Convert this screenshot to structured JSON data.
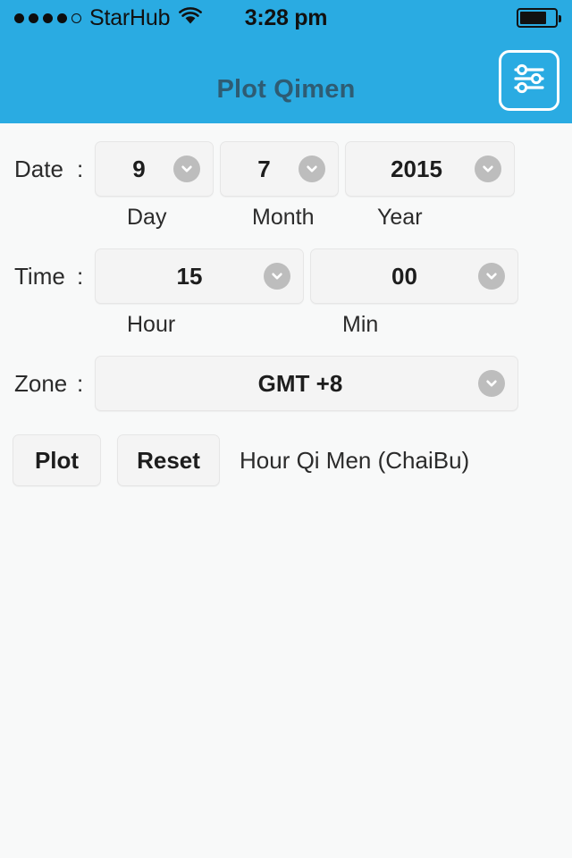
{
  "status_bar": {
    "signal_dots_filled": 4,
    "signal_dots_total": 5,
    "carrier": "StarHub",
    "wifi_icon": "wifi-icon",
    "time": "3:28 pm",
    "battery_icon": "battery-icon",
    "battery_level_percent": 75
  },
  "nav": {
    "title": "Plot Qimen",
    "settings_icon": "sliders-icon",
    "background_color": "#2aabe2",
    "title_color": "#2e5c73"
  },
  "form": {
    "date": {
      "label": "Date",
      "colon": ":",
      "fields": [
        {
          "value": "9",
          "sub_label": "Day",
          "chevron_icon": "chevron-down-icon"
        },
        {
          "value": "7",
          "sub_label": "Month",
          "chevron_icon": "chevron-down-icon"
        },
        {
          "value": "2015",
          "sub_label": "Year",
          "chevron_icon": "chevron-down-icon"
        }
      ]
    },
    "time": {
      "label": "Time",
      "colon": ":",
      "fields": [
        {
          "value": "15",
          "sub_label": "Hour",
          "chevron_icon": "chevron-down-icon"
        },
        {
          "value": "00",
          "sub_label": "Min",
          "chevron_icon": "chevron-down-icon"
        }
      ]
    },
    "zone": {
      "label": "Zone",
      "colon": ":",
      "fields": [
        {
          "value": "GMT +8",
          "sub_label": "",
          "chevron_icon": "chevron-down-icon"
        }
      ]
    }
  },
  "actions": {
    "plot_label": "Plot",
    "reset_label": "Reset",
    "status_note": "Hour Qi Men (ChaiBu)"
  },
  "colors": {
    "accent": "#2aabe2",
    "page_background": "#f8f9f9",
    "field_background": "#f4f4f4",
    "chevron_circle": "#bdbdbd",
    "text": "#2b2b2b"
  }
}
